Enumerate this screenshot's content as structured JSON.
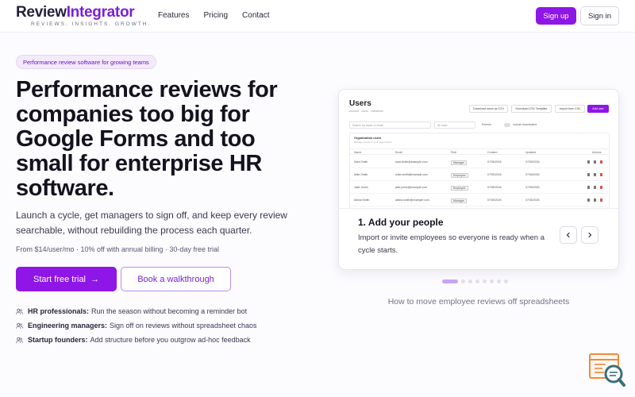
{
  "header": {
    "logo_part1": "Review",
    "logo_part2": "Integrator",
    "tagline": "REVIEWS. INSIGHTS. GROWTH.",
    "nav": [
      "Features",
      "Pricing",
      "Contact"
    ],
    "signup_label": "Sign up",
    "signin_label": "Sign in"
  },
  "hero": {
    "pill": "Performance review software for growing teams",
    "headline": "Performance reviews for companies too big for Google Forms and too small for enterprise HR software.",
    "subcopy": "Launch a cycle, get managers to sign off, and keep every review searchable, without rebuilding the process each quarter.",
    "pricing": "From $14/user/mo · 10% off with annual billing · 30-day free trial",
    "cta_primary": "Start free trial",
    "cta_primary_arrow": "→",
    "cta_secondary": "Book a walkthrough",
    "personas": [
      {
        "role": "HR professionals:",
        "text": "Run the season without becoming a reminder bot"
      },
      {
        "role": "Engineering managers:",
        "text": "Sign off on reviews without spreadsheet chaos"
      },
      {
        "role": "Startup founders:",
        "text": "Add structure before you outgrow ad-hoc feedback"
      }
    ]
  },
  "showcase": {
    "screenshot": {
      "title": "Users",
      "breadcrumb": "account · users · invitations",
      "buttons": [
        "Download users as CSV",
        "Download CSV Template",
        "Import from CSV",
        "Add user"
      ],
      "search_placeholder": "Search by name or email",
      "filter": "All roles",
      "refresh": "Refresh",
      "include_deactivated": "Include deactivated",
      "table_title": "Organization users",
      "table_subtitle": "Manage people in your organization",
      "columns": [
        "Name",
        "Email",
        "Role",
        "Created",
        "Updated",
        "Actions"
      ],
      "rows": [
        {
          "name": "Sara Smith",
          "email": "sara.smith@example.com",
          "role": "Manager",
          "created": "07/05/2026",
          "updated": "07/05/2026"
        },
        {
          "name": "Mike Smith",
          "email": "mike.smith@example.com",
          "role": "Employee",
          "created": "07/05/2026",
          "updated": "07/05/2026"
        },
        {
          "name": "Jake Jones",
          "email": "jake.jones@example.com",
          "role": "Employee",
          "created": "07/05/2026",
          "updated": "07/05/2026"
        },
        {
          "name": "Alisha Smith",
          "email": "alisha.smith@example.com",
          "role": "Manager",
          "created": "07/05/2026",
          "updated": "07/05/2026"
        }
      ]
    },
    "step_title": "1. Add your people",
    "step_desc": "Import or invite employees so everyone is ready when a cycle starts.",
    "prev_icon": "chevron-left-icon",
    "next_icon": "chevron-right-icon",
    "slides_total": 8,
    "active_slide": 1,
    "caption": "How to move employee reviews off spreadsheets"
  },
  "colors": {
    "brand": "#8e16e6",
    "brand_text": "#7a1fd9",
    "pill_bg": "#f3eafc",
    "widget_orange": "#f08a3a",
    "widget_teal": "#3a6e78"
  }
}
